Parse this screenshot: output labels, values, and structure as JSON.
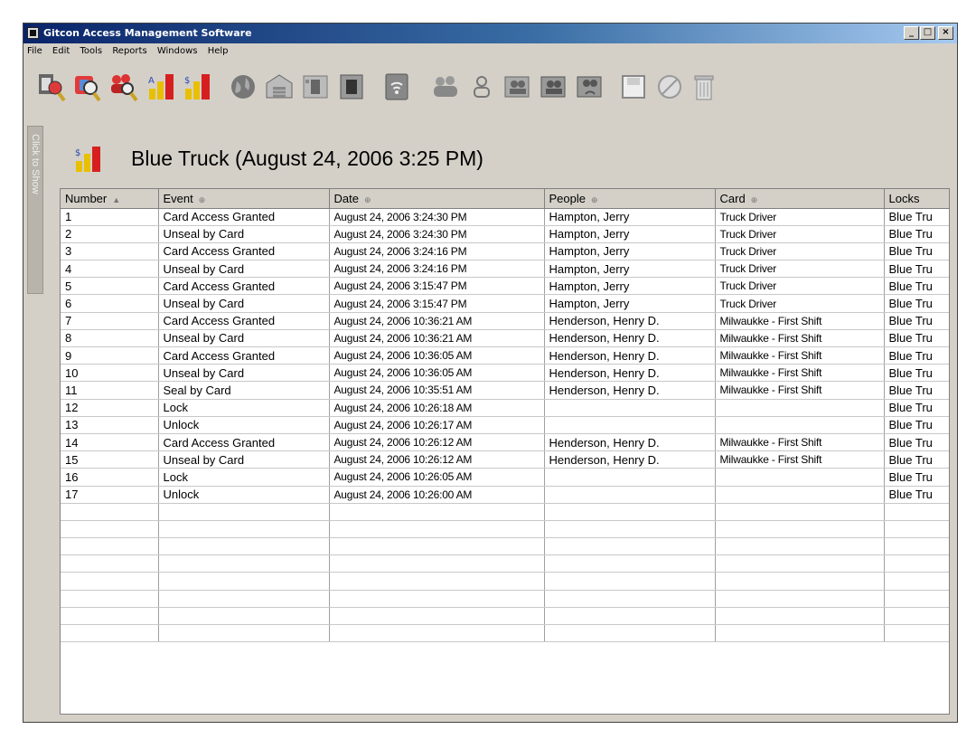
{
  "window": {
    "title": "Gitcon Access Management Software",
    "controls": [
      "_",
      "□",
      "×"
    ]
  },
  "menu": [
    "File",
    "Edit",
    "Tools",
    "Reports",
    "Windows",
    "Help"
  ],
  "toolbar_icons": [
    "find-events-icon",
    "find-cards-icon",
    "find-people-icon",
    "report-icon",
    "report-alt-icon",
    "globe-icon",
    "building-icon",
    "panel-icon",
    "lock-device-icon",
    "wireless-icon",
    "group-people-icon",
    "person-icon",
    "group-card-icon",
    "group-card-alt-icon",
    "group-card-wireless-icon",
    "save-icon",
    "cancel-icon",
    "trash-icon"
  ],
  "sidebar_tab": "Click to Show",
  "heading": "Blue Truck (August 24, 2006 3:25 PM)",
  "table": {
    "columns": [
      "Number",
      "Event",
      "Date",
      "People",
      "Card",
      "Locks"
    ],
    "rows": [
      [
        "1",
        "Card Access Granted",
        "August 24, 2006 3:24:30 PM",
        "Hampton, Jerry",
        "Truck Driver",
        "Blue Tru"
      ],
      [
        "2",
        "Unseal by Card",
        "August 24, 2006 3:24:30 PM",
        "Hampton, Jerry",
        "Truck Driver",
        "Blue Tru"
      ],
      [
        "3",
        "Card Access Granted",
        "August 24, 2006 3:24:16 PM",
        "Hampton, Jerry",
        "Truck Driver",
        "Blue Tru"
      ],
      [
        "4",
        "Unseal by Card",
        "August 24, 2006 3:24:16 PM",
        "Hampton, Jerry",
        "Truck Driver",
        "Blue Tru"
      ],
      [
        "5",
        "Card Access Granted",
        "August 24, 2006 3:15:47 PM",
        "Hampton, Jerry",
        "Truck Driver",
        "Blue Tru"
      ],
      [
        "6",
        "Unseal by Card",
        "August 24, 2006 3:15:47 PM",
        "Hampton, Jerry",
        "Truck Driver",
        "Blue Tru"
      ],
      [
        "7",
        "Card Access Granted",
        "August 24, 2006 10:36:21 AM",
        "Henderson, Henry D.",
        "Milwaukke - First Shift",
        "Blue Tru"
      ],
      [
        "8",
        "Unseal by Card",
        "August 24, 2006 10:36:21 AM",
        "Henderson, Henry D.",
        "Milwaukke - First Shift",
        "Blue Tru"
      ],
      [
        "9",
        "Card Access Granted",
        "August 24, 2006 10:36:05 AM",
        "Henderson, Henry D.",
        "Milwaukke - First Shift",
        "Blue Tru"
      ],
      [
        "10",
        "Unseal by Card",
        "August 24, 2006 10:36:05 AM",
        "Henderson, Henry D.",
        "Milwaukke - First Shift",
        "Blue Tru"
      ],
      [
        "11",
        "Seal by Card",
        "August 24, 2006 10:35:51 AM",
        "Henderson, Henry D.",
        "Milwaukke - First Shift",
        "Blue Tru"
      ],
      [
        "12",
        "Lock",
        "August 24, 2006 10:26:18 AM",
        "",
        "",
        "Blue Tru"
      ],
      [
        "13",
        "Unlock",
        "August 24, 2006 10:26:17 AM",
        "",
        "",
        "Blue Tru"
      ],
      [
        "14",
        "Card Access Granted",
        "August 24, 2006 10:26:12 AM",
        "Henderson, Henry D.",
        "Milwaukke - First Shift",
        "Blue Tru"
      ],
      [
        "15",
        "Unseal by Card",
        "August 24, 2006 10:26:12 AM",
        "Henderson, Henry D.",
        "Milwaukke - First Shift",
        "Blue Tru"
      ],
      [
        "16",
        "Lock",
        "August 24, 2006 10:26:05 AM",
        "",
        "",
        "Blue Tru"
      ],
      [
        "17",
        "Unlock",
        "August 24, 2006 10:26:00 AM",
        "",
        "",
        "Blue Tru"
      ]
    ],
    "empty_rows": 8
  }
}
